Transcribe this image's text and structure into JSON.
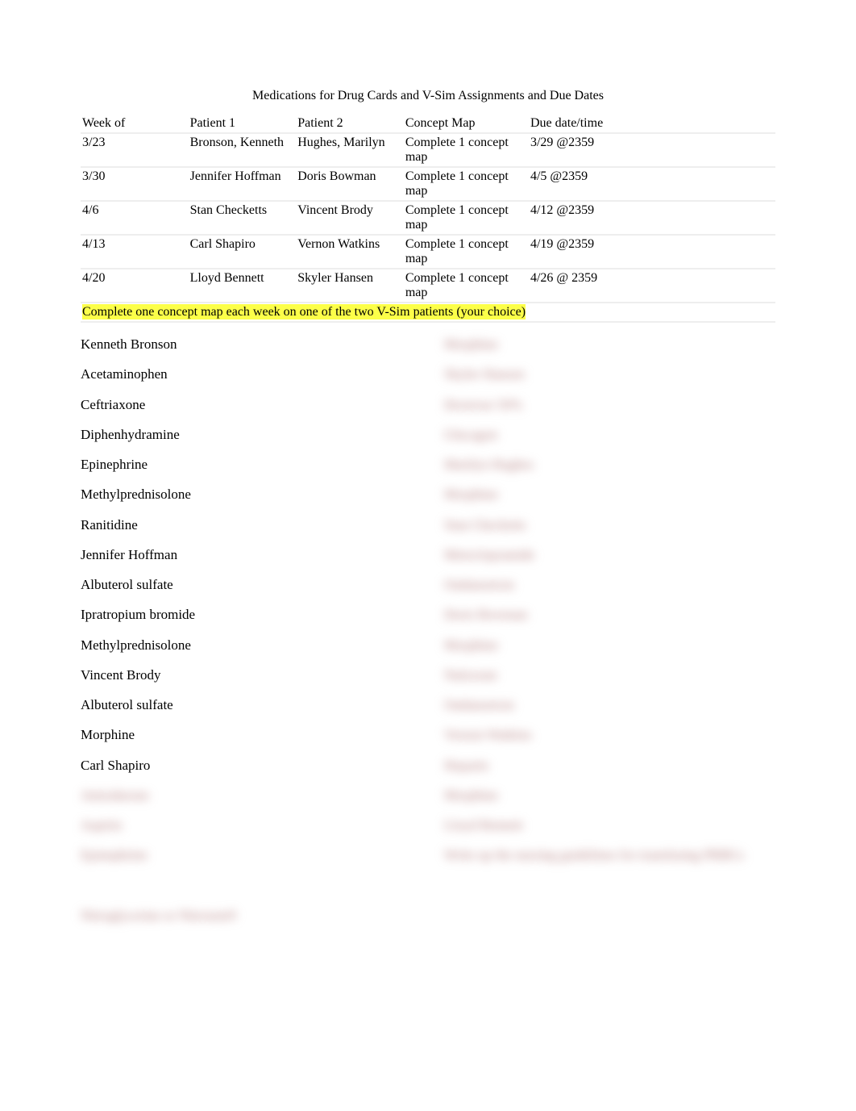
{
  "title": "Medications for Drug Cards and V-Sim Assignments and Due Dates",
  "table": {
    "headers": {
      "week": "Week of",
      "p1": "Patient 1",
      "p2": "Patient 2",
      "cmap": "Concept Map",
      "due": "Due date/time"
    },
    "rows": [
      {
        "week": "3/23",
        "p1": "Bronson, Kenneth",
        "p2": "Hughes, Marilyn",
        "cmap": "Complete 1 concept map",
        "due": "3/29 @2359"
      },
      {
        "week": "3/30",
        "p1": "Jennifer Hoffman",
        "p2": "Doris Bowman",
        "cmap": "Complete 1 concept map",
        "due": "4/5 @2359"
      },
      {
        "week": "4/6",
        "p1": "Stan Checketts",
        "p2": "Vincent Brody",
        "cmap": "Complete 1 concept map",
        "due": "4/12 @2359"
      },
      {
        "week": "4/13",
        "p1": "Carl Shapiro",
        "p2": "Vernon Watkins",
        "cmap": "Complete 1 concept map",
        "due": "4/19 @2359"
      },
      {
        "week": "4/20",
        "p1": "Lloyd Bennett",
        "p2": "Skyler Hansen",
        "cmap": "Complete 1 concept map",
        "due": "4/26 @ 2359"
      }
    ]
  },
  "note": "Complete one concept map each week on one of the two V-Sim patients (your choice)",
  "left_column": [
    {
      "text": "Kenneth Bronson",
      "blurred": false
    },
    {
      "text": "Acetaminophen",
      "blurred": false
    },
    {
      "text": "Ceftriaxone",
      "blurred": false
    },
    {
      "text": "Diphenhydramine",
      "blurred": false
    },
    {
      "text": "Epinephrine",
      "blurred": false
    },
    {
      "text": "Methylprednisolone",
      "blurred": false
    },
    {
      "text": "Ranitidine",
      "blurred": false
    },
    {
      "text": "Jennifer Hoffman",
      "blurred": false
    },
    {
      "text": "Albuterol sulfate",
      "blurred": false
    },
    {
      "text": "Ipratropium bromide",
      "blurred": false
    },
    {
      "text": "Methylprednisolone",
      "blurred": false
    },
    {
      "text": "Vincent Brody",
      "blurred": false
    },
    {
      "text": "Albuterol sulfate",
      "blurred": false
    },
    {
      "text": "Morphine",
      "blurred": false
    },
    {
      "text": "Carl Shapiro",
      "blurred": false
    },
    {
      "text": "Amiodarone",
      "blurred": true
    },
    {
      "text": "Aspirin",
      "blurred": true
    },
    {
      "text": "Epinephrine",
      "blurred": true
    },
    {
      "text": "",
      "blurred": false
    },
    {
      "text": "Nitroglycerine or Nitrostat®",
      "blurred": true
    }
  ],
  "right_column": [
    {
      "text": "Morphine",
      "blurred": true
    },
    {
      "text": "Skyler Hansen",
      "blurred": true
    },
    {
      "text": "Dextrose 50%",
      "blurred": true
    },
    {
      "text": "Glucagon",
      "blurred": true
    },
    {
      "text": "Marilyn Hughes",
      "blurred": true
    },
    {
      "text": "Morphine",
      "blurred": true
    },
    {
      "text": "Stan Checketts",
      "blurred": true
    },
    {
      "text": "Metoclopramide",
      "blurred": true
    },
    {
      "text": "Ondansetron",
      "blurred": true
    },
    {
      "text": "Doris Bowman",
      "blurred": true
    },
    {
      "text": "Morphine",
      "blurred": true
    },
    {
      "text": "Naloxone",
      "blurred": true
    },
    {
      "text": "Ondansetron",
      "blurred": true
    },
    {
      "text": "Vernon Watkins",
      "blurred": true
    },
    {
      "text": "Heparin",
      "blurred": true
    },
    {
      "text": "Morphine",
      "blurred": true
    },
    {
      "text": "Lloyd Bennett",
      "blurred": true
    },
    {
      "text": "Write up the nursing guidelines for transfusing PRBCs",
      "blurred": true
    }
  ]
}
